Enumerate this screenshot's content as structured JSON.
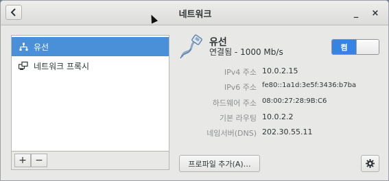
{
  "window": {
    "title": "네트워크",
    "minimize_label": "_",
    "close_label": "×"
  },
  "sidebar": {
    "items": [
      {
        "label": "유선",
        "icon": "wired-network-icon",
        "selected": true
      },
      {
        "label": "네트워크 프록시",
        "icon": "network-proxy-icon",
        "selected": false
      }
    ],
    "add_label": "+",
    "remove_label": "−"
  },
  "connection": {
    "name": "유선",
    "status": "연결됨 - 1000 Mb/s",
    "toggle_label": "켬",
    "toggle_on": true
  },
  "details": [
    {
      "label": "IPv4 주소",
      "value": "10.0.2.15"
    },
    {
      "label": "IPv6 주소",
      "value": "fe80::1a1d:3e5f:3436:b7ba"
    },
    {
      "label": "하드웨어 주소",
      "value": "08:00:27:28:9B:C6"
    },
    {
      "label": "기본 라우팅",
      "value": "10.0.2.2"
    },
    {
      "label": "네임서버(DNS)",
      "value": "202.30.55.11"
    }
  ],
  "buttons": {
    "add_profile": "프로파일 추가(A)…"
  },
  "colors": {
    "accent": "#4a90d9",
    "toggle_on": "#3584e4",
    "label_gray": "#8b8e8f",
    "text": "#2e3436"
  }
}
